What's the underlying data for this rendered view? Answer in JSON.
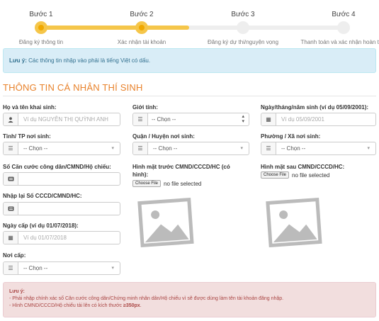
{
  "steps": [
    {
      "title": "Bước 1",
      "sub": "Đăng ký thông tin"
    },
    {
      "title": "Bước 2",
      "sub": "Xác nhận tài khoản"
    },
    {
      "title": "Bước 3",
      "sub": "Đăng ký dự thi/nguyện vọng"
    },
    {
      "title": "Bước 4",
      "sub": "Thanh toán và xác nhận hoàn tất"
    }
  ],
  "info": {
    "bold": "Lưu ý:",
    "text": " Các thông tin nhập vào phải là tiếng Việt có dấu."
  },
  "section_title": "THÔNG TIN CÁ NHÂN THÍ SINH",
  "fields": {
    "fullname": {
      "label": "Họ và tên khai sinh:",
      "placeholder": "Ví dụ NGUYỄN THỊ QUỲNH ANH"
    },
    "gender": {
      "label": "Giới tính:",
      "value": "-- Chọn --"
    },
    "dob": {
      "label": "Ngày/tháng/năm sinh (ví dụ 05/09/2001):",
      "placeholder": "Ví dụ 05/09/2001"
    },
    "province": {
      "label": "Tỉnh/ TP nơi sinh:",
      "value": "-- Chọn --"
    },
    "district": {
      "label": "Quận / Huyện nơi sinh:",
      "value": "-- Chọn --"
    },
    "ward": {
      "label": "Phường / Xã nơi sinh:",
      "value": "-- Chọn --"
    },
    "id_number": {
      "label": "Số Căn cước công dân/CMND/Hộ chiếu:"
    },
    "id_front": {
      "label_1": "Hình mặt trước CMND/CCCD/HC (có",
      "label_2": "hình):",
      "button": "Choose File",
      "status": "no file selected"
    },
    "id_back": {
      "label": "Hình mặt sau CMND/CCCD/HC:",
      "button": "Choose File",
      "status": "no file selected"
    },
    "id_confirm": {
      "label": "Nhập lại Số CCCD/CMND/HC:"
    },
    "issue_date": {
      "label": "Ngày cấp (ví dụ 01/07/2018):",
      "placeholder": "Ví dụ 01/07/2018"
    },
    "issue_place": {
      "label": "Nơi cấp:",
      "value": "-- Chọn --"
    }
  },
  "warning": {
    "title": "Lưu ý:",
    "line1": "- Phải nhập chính xác số Căn cước công dân/Chứng minh nhân dân/Hộ chiếu vì sẽ được dùng làm tên tài khoản đăng nhập.",
    "line2_pre": "- Hình CMND/CCCD/Hộ chiếu tải lên có kích thước ",
    "line2_bold": "≥350px",
    "line2_post": "."
  },
  "colors": {
    "accent": "#e8822b",
    "step_active": "#f5c64a",
    "info_bg": "#d9edf7",
    "warn_bg": "#f2dede"
  }
}
